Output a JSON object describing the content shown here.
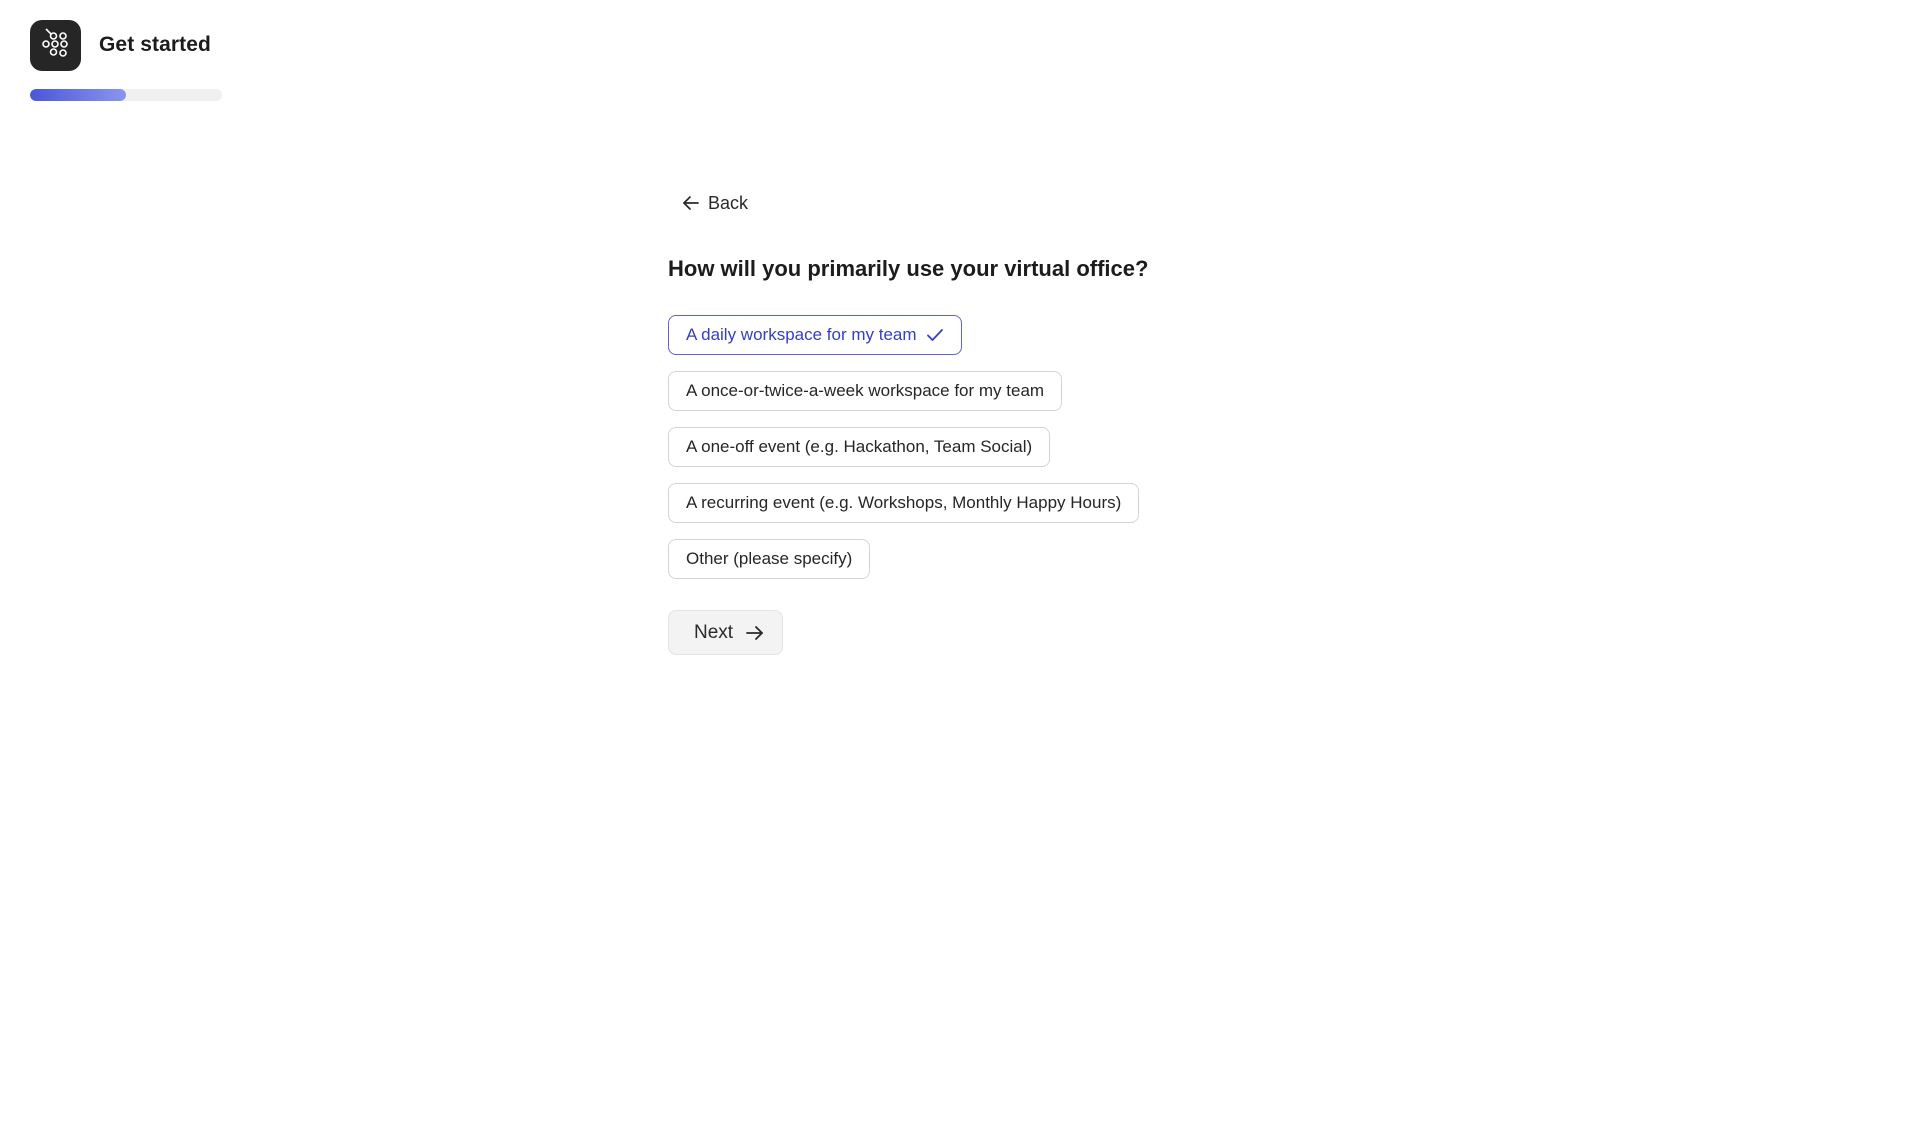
{
  "header": {
    "logo_icon": "molecule-network-icon",
    "title": "Get started",
    "progress": 0.5
  },
  "nav": {
    "back_label": "Back",
    "back_icon": "arrow-left-icon"
  },
  "question": {
    "text": "How will you primarily use your virtual office?",
    "options": [
      {
        "label": "A daily workspace for my team",
        "selected": true
      },
      {
        "label": "A once-or-twice-a-week workspace for my team",
        "selected": false
      },
      {
        "label": "A one-off event (e.g. Hackathon, Team Social)",
        "selected": false
      },
      {
        "label": "A recurring event (e.g. Workshops, Monthly Happy Hours)",
        "selected": false
      },
      {
        "label": "Other (please specify)",
        "selected": false
      }
    ]
  },
  "actions": {
    "next_label": "Next",
    "next_icon": "arrow-right-icon"
  },
  "colors": {
    "accent": "#3440c4",
    "accent_border": "#5a66d8",
    "progress_start": "#4a57d8",
    "progress_end": "#8b95ee",
    "logo_bg": "#262626"
  }
}
